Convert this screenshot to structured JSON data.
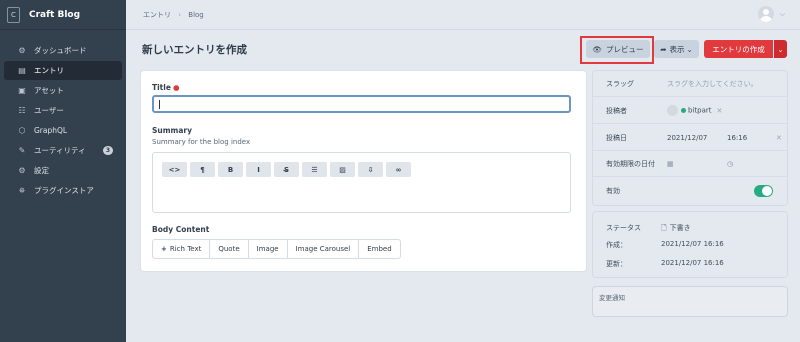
{
  "app": {
    "name": "Craft Blog",
    "logo_letter": "C"
  },
  "sidebar": {
    "items": [
      {
        "label": "ダッシュボード",
        "icon": "dashboard-icon",
        "glyph": "⚙"
      },
      {
        "label": "エントリ",
        "icon": "entries-icon",
        "glyph": "▤",
        "active": true
      },
      {
        "label": "アセット",
        "icon": "assets-icon",
        "glyph": "▣"
      },
      {
        "label": "ユーザー",
        "icon": "users-icon",
        "glyph": "☷"
      },
      {
        "label": "GraphQL",
        "icon": "graphql-icon",
        "glyph": "⬡"
      },
      {
        "label": "ユーティリティ",
        "icon": "utilities-icon",
        "glyph": "✎",
        "badge": "3"
      },
      {
        "label": "設定",
        "icon": "settings-icon",
        "glyph": "⚙"
      },
      {
        "label": "プラグインストア",
        "icon": "plugin-store-icon",
        "glyph": "⛯"
      }
    ]
  },
  "breadcrumb": {
    "items": [
      "エントリ",
      "Blog"
    ]
  },
  "header": {
    "title": "新しいエントリを作成",
    "preview_label": "プレビュー",
    "view_label": "表示",
    "save_label": "エントリの作成"
  },
  "fields": {
    "title": {
      "label": "Title",
      "value": ""
    },
    "summary": {
      "label": "Summary",
      "instructions": "Summary for the blog index"
    },
    "toolbar": [
      {
        "glyph": "<>",
        "icon": "html-icon"
      },
      {
        "glyph": "¶",
        "icon": "paragraph-icon"
      },
      {
        "glyph": "B",
        "icon": "bold-icon"
      },
      {
        "glyph": "I",
        "icon": "italic-icon"
      },
      {
        "glyph": "S̶",
        "icon": "strikethrough-icon"
      },
      {
        "glyph": "☰",
        "icon": "list-icon"
      },
      {
        "glyph": "▨",
        "icon": "image-icon"
      },
      {
        "glyph": "⇩",
        "icon": "file-icon"
      },
      {
        "glyph": "∞",
        "icon": "link-icon"
      }
    ],
    "body": {
      "label": "Body Content",
      "blocks": [
        "Rich Text",
        "Quote",
        "Image",
        "Image Carousel",
        "Embed"
      ],
      "add_prefix": "+"
    }
  },
  "meta": {
    "slug": {
      "label": "スラッグ",
      "placeholder": "スラグを入力してください。"
    },
    "author": {
      "label": "投稿者",
      "value": "bitpart"
    },
    "post_date": {
      "label": "投稿日",
      "date": "2021/12/07",
      "time": "16:16"
    },
    "expiry": {
      "label": "有効期限の日付"
    },
    "enabled": {
      "label": "有効",
      "value": true
    }
  },
  "status": {
    "status_label": "ステータス",
    "status_value": "下書き",
    "created_label": "作成：",
    "created_value": "2021/12/07 16:16",
    "updated_label": "更新：",
    "updated_value": "2021/12/07 16:16"
  },
  "notes": {
    "placeholder": "変更通知"
  },
  "colors": {
    "accent": "#e0393e",
    "sidebar": "#33404d",
    "toggle_on": "#27ab83"
  }
}
